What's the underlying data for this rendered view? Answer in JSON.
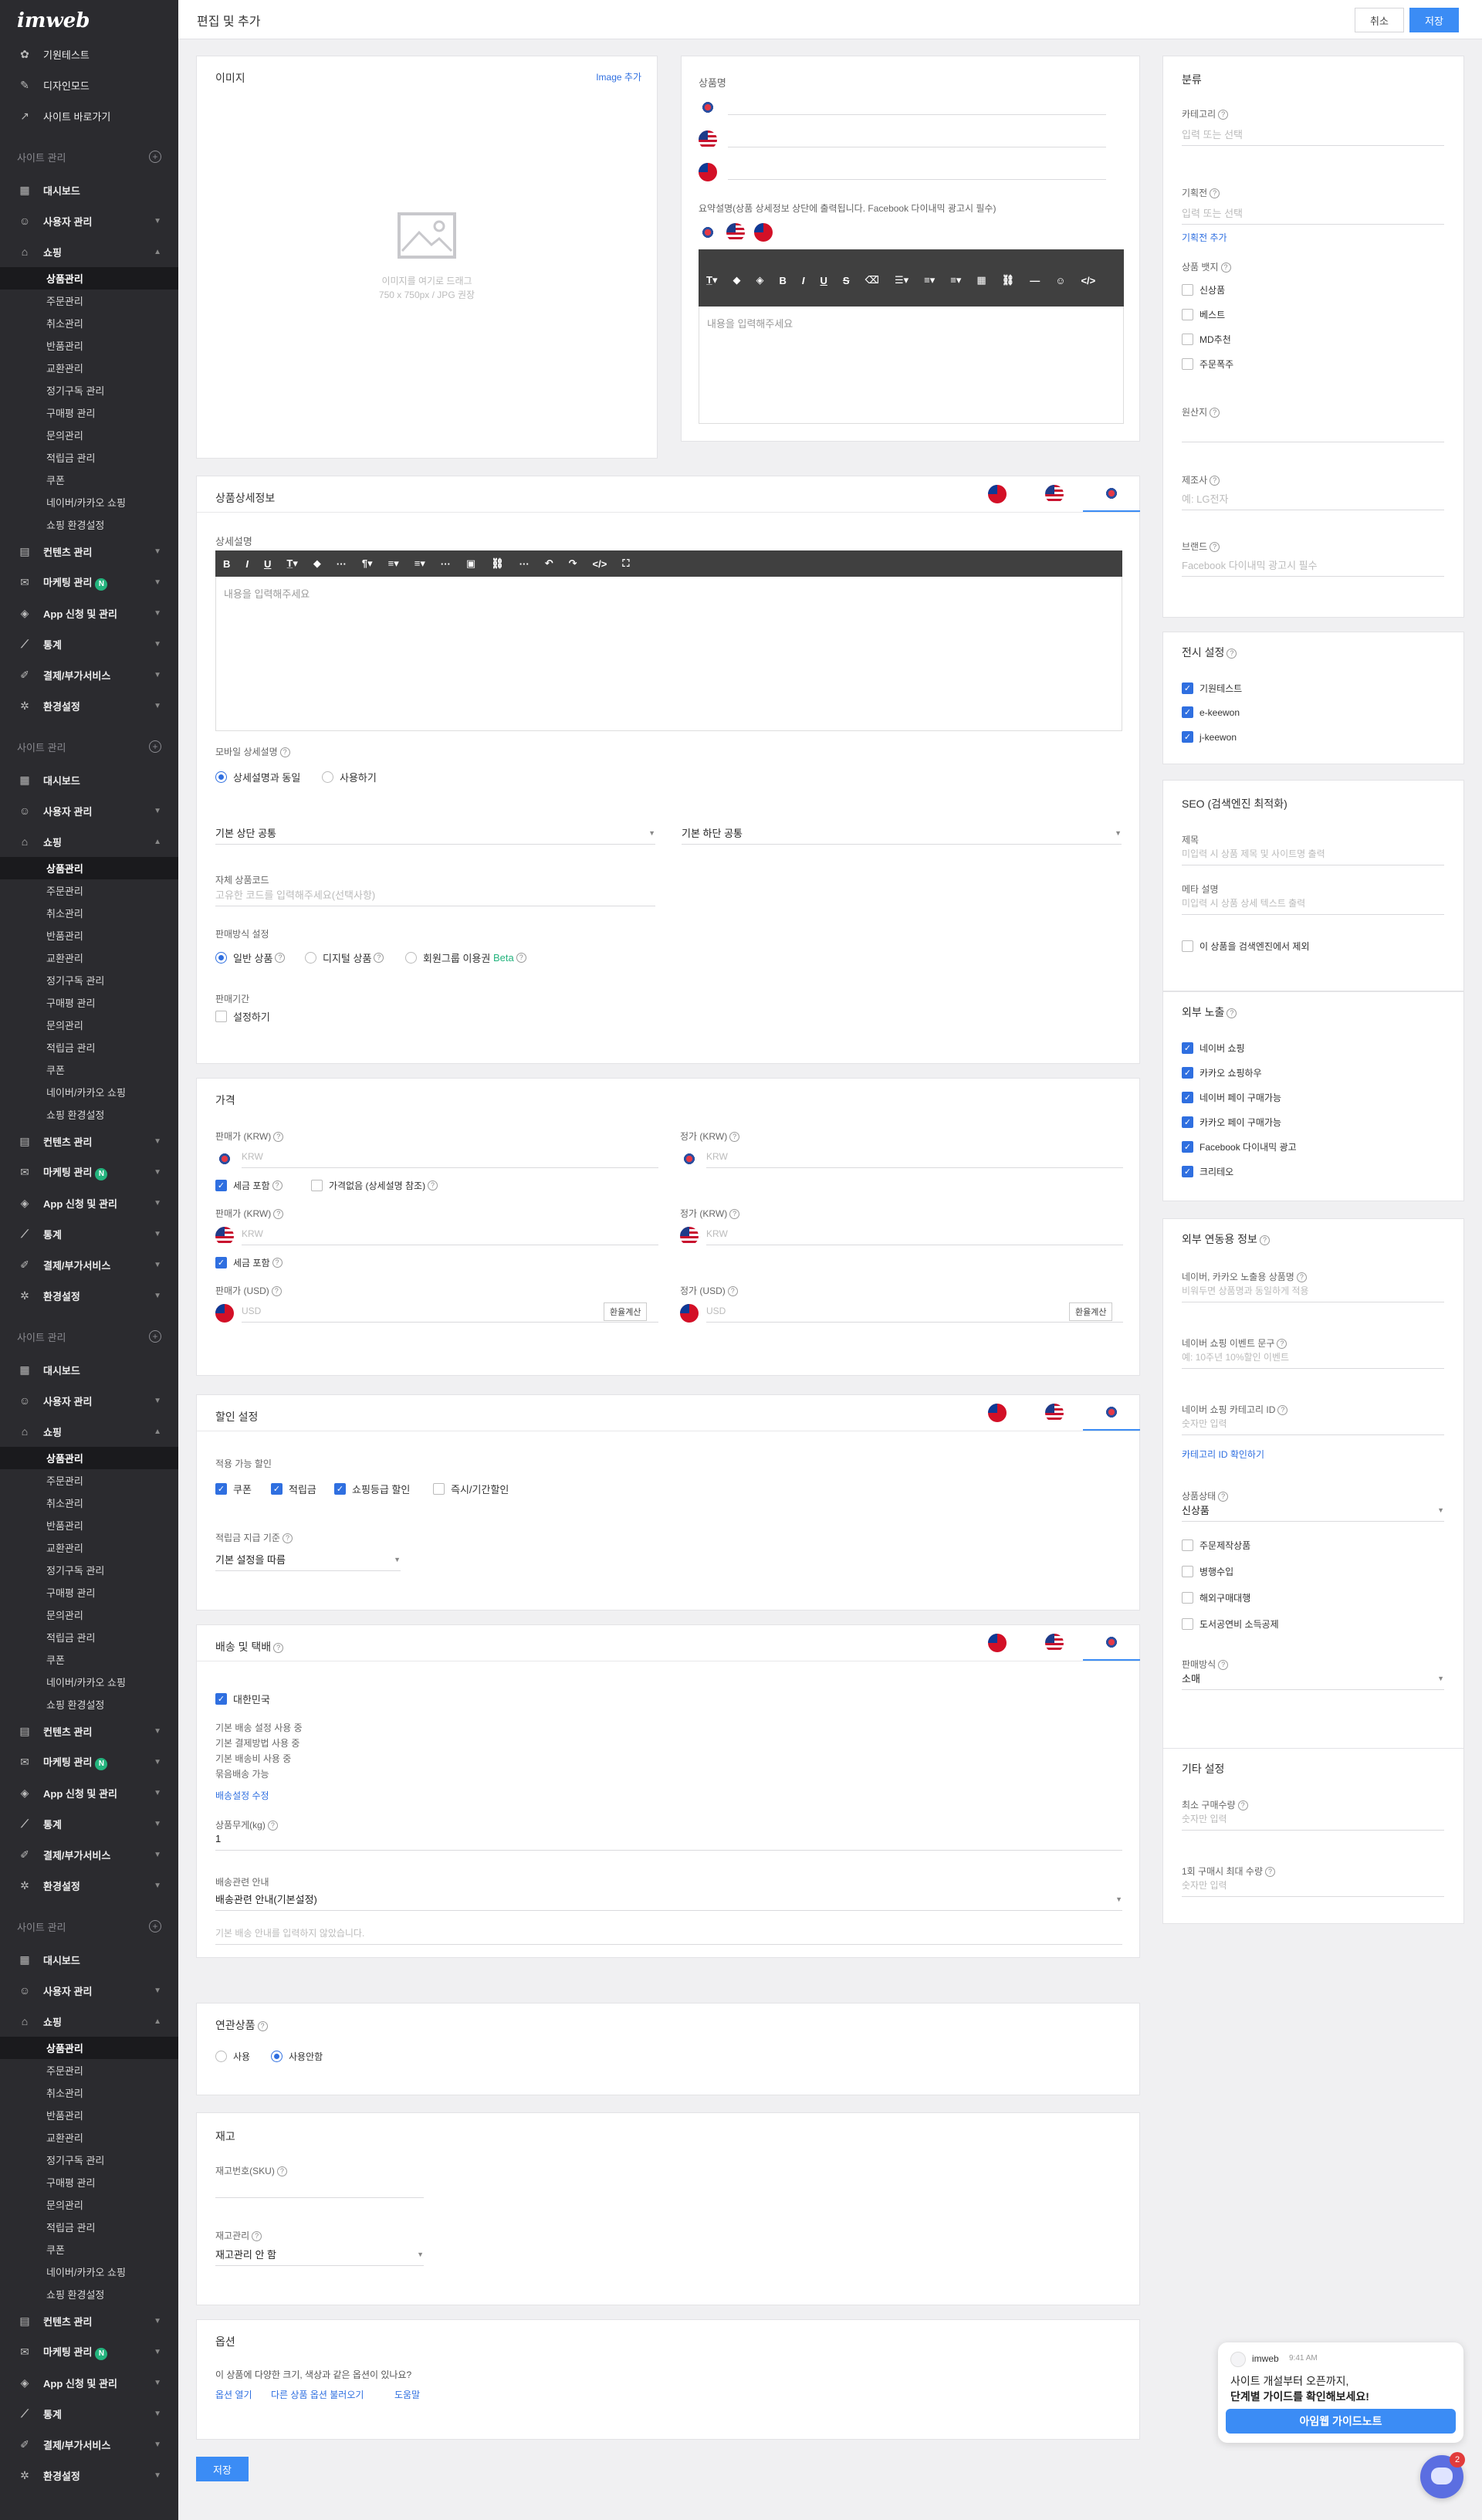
{
  "sidebar": {
    "logo": "imweb",
    "top_items": [
      {
        "label": "기원테스트",
        "icon": "globe-icon"
      },
      {
        "label": "디자인모드",
        "icon": "pen-icon"
      },
      {
        "label": "사이트 바로가기",
        "icon": "external-link-icon"
      }
    ],
    "section_header": "사이트 관리",
    "groups": [
      {
        "label": "대시보드",
        "icon": "dashboard-icon"
      },
      {
        "label": "사용자 관리",
        "icon": "user-icon"
      },
      {
        "label": "쇼핑",
        "icon": "shopping-bag-icon"
      }
    ],
    "shop_sub": [
      "상품관리",
      "주문관리",
      "취소관리",
      "반품관리",
      "교환관리",
      "정기구독 관리",
      "구매평 관리",
      "문의관리",
      "적립금 관리",
      "쿠폰",
      "네이버/카카오 쇼핑",
      "쇼핑 환경설정"
    ],
    "after_groups": [
      {
        "label": "컨텐츠 관리",
        "icon": "content-icon"
      },
      {
        "label": "마케팅 관리",
        "icon": "megaphone-icon",
        "badge": "N"
      },
      {
        "label": "App 신청 및 관리",
        "icon": "app-icon"
      },
      {
        "label": "통계",
        "icon": "chart-icon"
      },
      {
        "label": "결제/부가서비스",
        "icon": "wrench-icon"
      },
      {
        "label": "환경설정",
        "icon": "gear-icon"
      }
    ]
  },
  "header": {
    "title": "편집 및 추가",
    "cancel": "취소",
    "save": "저장"
  },
  "image_card": {
    "title": "이미지",
    "add": "Image 추가",
    "hint1": "이미지를 여기로 드래그",
    "hint2": "750 x 750px / JPG 권장"
  },
  "name_card": {
    "label": "상품명",
    "summary_label": "요약설명(상품 상세정보 상단에 출력됩니다. Facebook 다이내믹 광고시 필수)",
    "editor_placeholder": "내용을 입력해주세요"
  },
  "detail_card": {
    "title": "상품상세정보",
    "detail_label": "상세설명",
    "editor_placeholder": "내용을 입력해주세요",
    "mobile_label": "모바일 상세설명",
    "mobile_opt1": "상세설명과 동일",
    "mobile_opt2": "사용하기",
    "top_common": "기본 상단 공통",
    "bottom_common": "기본 하단 공통",
    "code_label": "자체 상품코드",
    "code_placeholder": "고유한 코드를 입력해주세요(선택사항)",
    "sale_label": "판매방식 설정",
    "sale_opt1": "일반 상품",
    "sale_opt2": "디지털 상품",
    "sale_opt3": "회원그룹 이용권",
    "beta": "Beta",
    "period_label": "판매기간",
    "period_opt": "설정하기"
  },
  "price_card": {
    "title": "가격",
    "sale_krw": "판매가 (KRW)",
    "regular_krw": "정가 (KRW)",
    "sale_usd": "판매가 (USD)",
    "regular_usd": "정가 (USD)",
    "krw": "KRW",
    "usd": "USD",
    "tax": "세금 포함",
    "no_price": "가격없음 (상세설명 참조)",
    "exchange": "환율계산"
  },
  "discount_card": {
    "title": "할인 설정",
    "applicable": "적용 가능 할인",
    "opt1": "쿠폰",
    "opt2": "적립금",
    "opt3": "쇼핑등급 할인",
    "opt4": "즉시/기간할인",
    "basis_label": "적립금 지급 기준",
    "basis_value": "기본 설정을 따름"
  },
  "shipping_card": {
    "title": "배송 및 택배",
    "country": "대한민국",
    "lines": [
      "기본 배송 설정 사용 중",
      "기본 결제방법 사용 중",
      "기본 배송비 사용 중",
      "묶음배송 가능"
    ],
    "edit_link": "배송설정 수정",
    "weight_label": "상품무게(kg)",
    "weight_value": "1",
    "guide_label": "배송관련 안내",
    "guide_value": "배송관련 안내(기본설정)",
    "guide_hint": "기본 배송 안내를 입력하지 않았습니다."
  },
  "related_card": {
    "title": "연관상품",
    "opt1": "사용",
    "opt2": "사용안함"
  },
  "stock_card": {
    "title": "재고",
    "sku_label": "재고번호(SKU)",
    "manage_label": "재고관리",
    "manage_value": "재고관리 안 함"
  },
  "option_card": {
    "title": "옵션",
    "question": "이 상품에 다양한 크기, 색상과 같은 옵션이 있나요?",
    "open": "옵션 열기",
    "load": "다른 상품 옵션 불러오기",
    "help": "도움말"
  },
  "bottom_save": "저장",
  "right": {
    "category": {
      "title": "분류",
      "cat_label": "카테고리",
      "cat_placeholder": "입력 또는 선택",
      "plan_label": "기획전",
      "plan_placeholder": "입력 또는 선택",
      "plan_add": "기획전 추가",
      "badge_label": "상품 뱃지",
      "badges": [
        "신상품",
        "베스트",
        "MD추천",
        "주문폭주"
      ],
      "origin_label": "원산지",
      "maker_label": "제조사",
      "maker_placeholder": "예: LG전자",
      "brand_label": "브랜드",
      "brand_placeholder": "Facebook 다이내믹 광고시 필수"
    },
    "display": {
      "title": "전시 설정",
      "sites": [
        "기원테스트",
        "e-keewon",
        "j-keewon"
      ]
    },
    "seo": {
      "title": "SEO (검색엔진 최적화)",
      "title_label": "제목",
      "title_placeholder": "미입력 시 상품 제목 및 사이트명 출력",
      "meta_label": "메타 설명",
      "meta_placeholder": "미입력 시 상품 상세 텍스트 출력",
      "exclude": "이 상품을 검색엔진에서 제외"
    },
    "external": {
      "title": "외부 노출",
      "items": [
        "네이버 쇼핑",
        "카카오 쇼핑하우",
        "네이버 페이 구매가능",
        "카카오 페이 구매가능",
        "Facebook 다이내믹 광고",
        "크리테오"
      ]
    },
    "linked": {
      "title": "외부 연동용 정보",
      "name_label": "네이버, 카카오 노출용 상품명",
      "name_placeholder": "비워두면 상품명과 동일하게 적용",
      "event_label": "네이버 쇼핑 이벤트 문구",
      "event_placeholder": "예: 10주년 10%할인 이벤트",
      "cat_label": "네이버 쇼핑 카테고리 ID",
      "cat_placeholder": "숫자만 입력",
      "cat_link": "카테고리 ID 확인하기",
      "status_label": "상품상태",
      "status_value": "신상품",
      "checks": [
        "주문제작상품",
        "병행수입",
        "해외구매대행",
        "도서공연비 소득공제"
      ],
      "sale_label": "판매방식",
      "sale_value": "소매"
    },
    "etc": {
      "title": "기타 설정",
      "min_label": "최소 구매수량",
      "min_placeholder": "숫자만 입력",
      "max_label": "1회 구매시 최대 수량",
      "max_placeholder": "숫자만 입력"
    }
  },
  "help_popup": {
    "name": "imweb",
    "time": "9:41 AM",
    "line1": "사이트 개설부터 오픈까지,",
    "line2": "단계별 가이드를 확인해보세요!",
    "button": "아임웹 가이드노트",
    "badge": "2"
  }
}
